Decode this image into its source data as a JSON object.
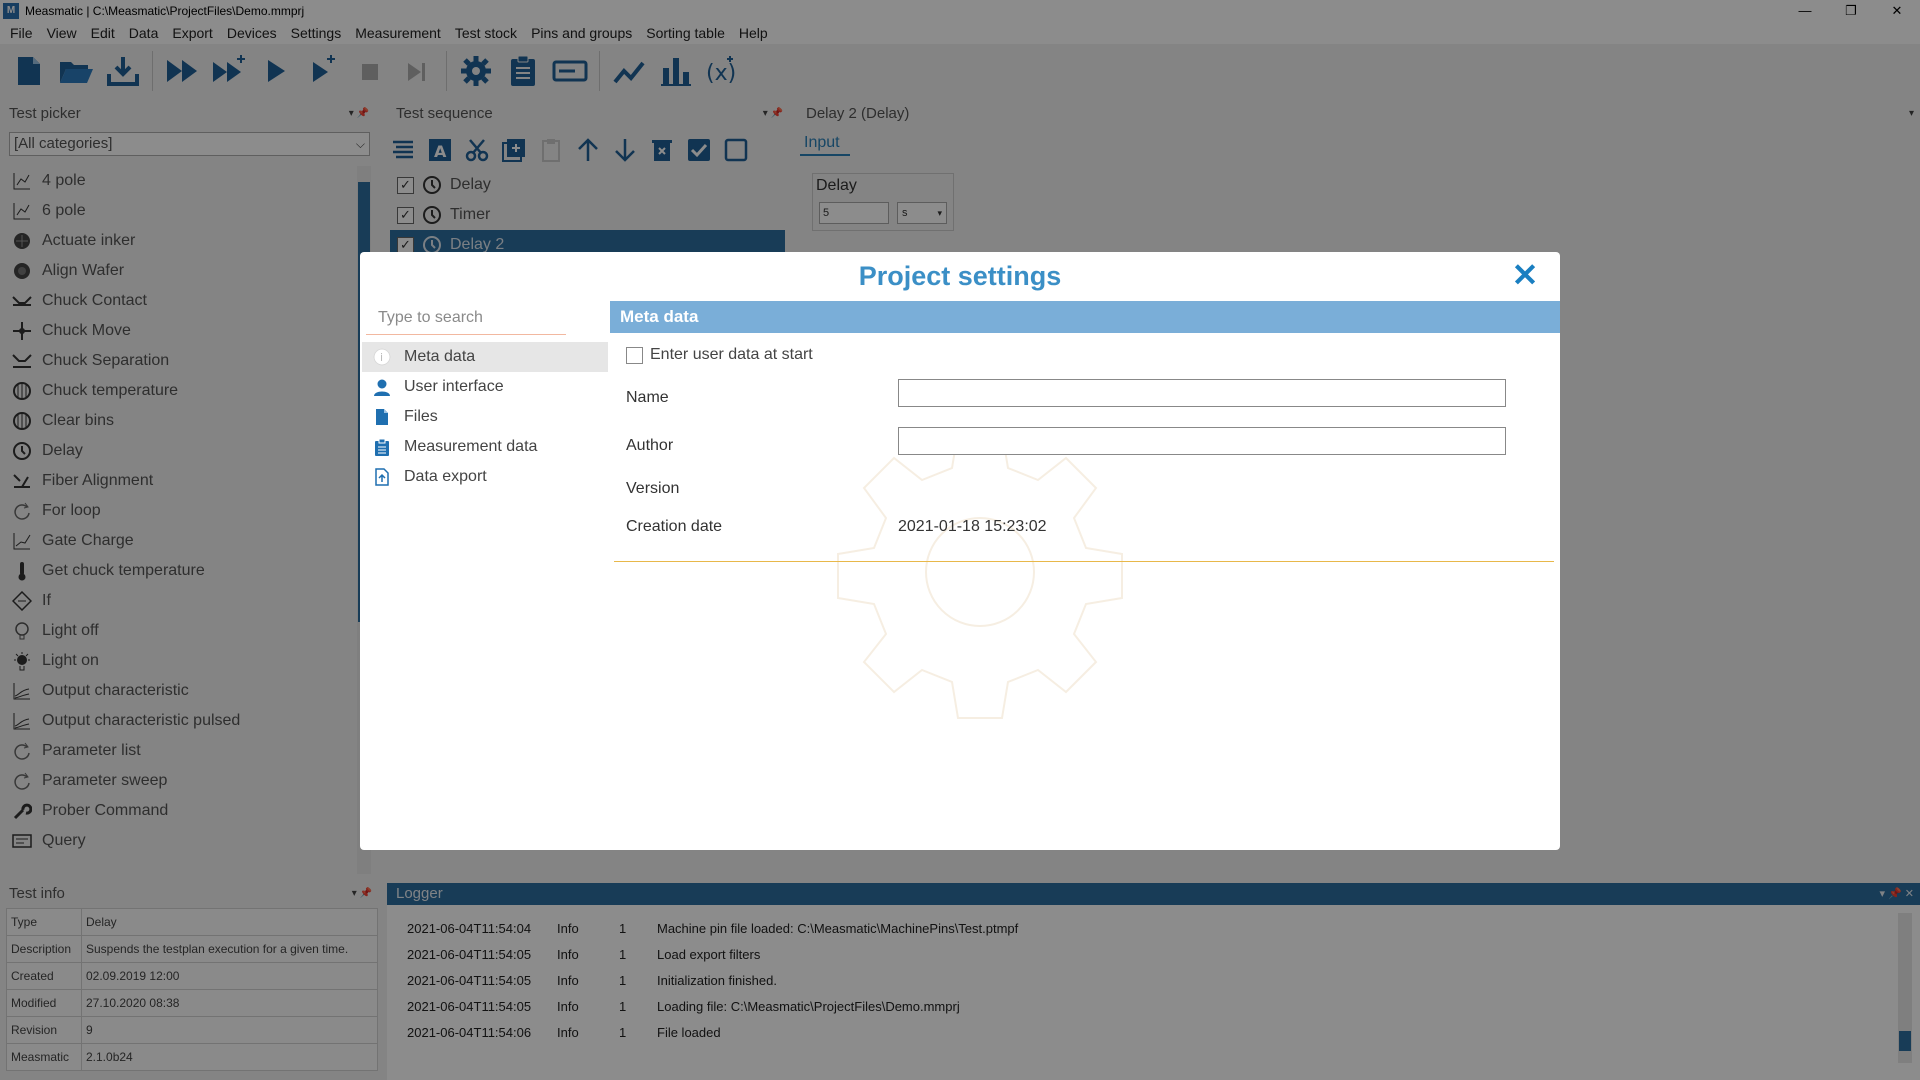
{
  "titlebar": {
    "title": "Measmatic | C:\\Measmatic\\ProjectFiles\\Demo.mmprj",
    "minimize": "—",
    "restore": "❐",
    "close": "✕"
  },
  "menu": [
    "File",
    "View",
    "Edit",
    "Data",
    "Export",
    "Devices",
    "Settings",
    "Measurement",
    "Test stock",
    "Pins and groups",
    "Sorting table",
    "Help"
  ],
  "test_picker": {
    "title": "Test picker",
    "category": "[All categories]",
    "items": [
      "4 pole",
      "6 pole",
      "Actuate inker",
      "Align Wafer",
      "Chuck Contact",
      "Chuck Move",
      "Chuck Separation",
      "Chuck temperature",
      "Clear bins",
      "Delay",
      "Fiber Alignment",
      "For loop",
      "Gate Charge",
      "Get chuck temperature",
      "If",
      "Light off",
      "Light on",
      "Output characteristic",
      "Output characteristic pulsed",
      "Parameter list",
      "Parameter sweep",
      "Prober Command",
      "Query"
    ]
  },
  "test_sequence": {
    "title": "Test sequence",
    "items": [
      {
        "label": "Delay",
        "checked": true
      },
      {
        "label": "Timer",
        "checked": true
      },
      {
        "label": "Delay 2",
        "checked": true
      }
    ]
  },
  "delay_panel": {
    "title": "Delay 2 (Delay)",
    "tab": "Input",
    "group_label": "Delay",
    "value": "5",
    "unit": "s"
  },
  "test_info": {
    "title": "Test info",
    "rows": [
      {
        "key": "Type",
        "value": "Delay"
      },
      {
        "key": "Description",
        "value": "Suspends the testplan execution for a given time."
      },
      {
        "key": "Created",
        "value": "02.09.2019 12:00"
      },
      {
        "key": "Modified",
        "value": "27.10.2020 08:38"
      },
      {
        "key": "Revision",
        "value": "9"
      },
      {
        "key": "Measmatic",
        "value": "2.1.0b24"
      }
    ]
  },
  "logger": {
    "title": "Logger",
    "rows": [
      {
        "ts": "2021-06-04T11:54:04",
        "level": "Info",
        "num": "1",
        "msg": "Machine pin file loaded: C:\\Measmatic\\MachinePins\\Test.ptmpf"
      },
      {
        "ts": "2021-06-04T11:54:05",
        "level": "Info",
        "num": "1",
        "msg": "Load export filters"
      },
      {
        "ts": "2021-06-04T11:54:05",
        "level": "Info",
        "num": "1",
        "msg": "Initialization finished."
      },
      {
        "ts": "2021-06-04T11:54:05",
        "level": "Info",
        "num": "1",
        "msg": "Loading file: C:\\Measmatic\\ProjectFiles\\Demo.mmprj"
      },
      {
        "ts": "2021-06-04T11:54:06",
        "level": "Info",
        "num": "1",
        "msg": "File loaded"
      }
    ]
  },
  "dialog": {
    "title": "Project settings",
    "close": "✕",
    "search_placeholder": "Type to search",
    "nav": [
      {
        "label": "Meta data",
        "icon": "info-icon",
        "active": true
      },
      {
        "label": "User interface",
        "icon": "user-icon",
        "active": false
      },
      {
        "label": "Files",
        "icon": "file-icon",
        "active": false
      },
      {
        "label": "Measurement data",
        "icon": "clipboard-icon",
        "active": false
      },
      {
        "label": "Data export",
        "icon": "export-icon",
        "active": false
      }
    ],
    "section": "Meta data",
    "enter_user_data_label": "Enter user data at start",
    "enter_user_data_checked": false,
    "name_label": "Name",
    "name_value": "",
    "author_label": "Author",
    "author_value": "",
    "version_label": "Version",
    "version_value": "",
    "creation_date_label": "Creation date",
    "creation_date_value": "2021-01-18 15:23:02"
  },
  "colors": {
    "accent": "#2d6d9e",
    "dialog_title": "#3b8fc6",
    "section_header": "#7aaed8",
    "divider": "#e8b84a"
  }
}
